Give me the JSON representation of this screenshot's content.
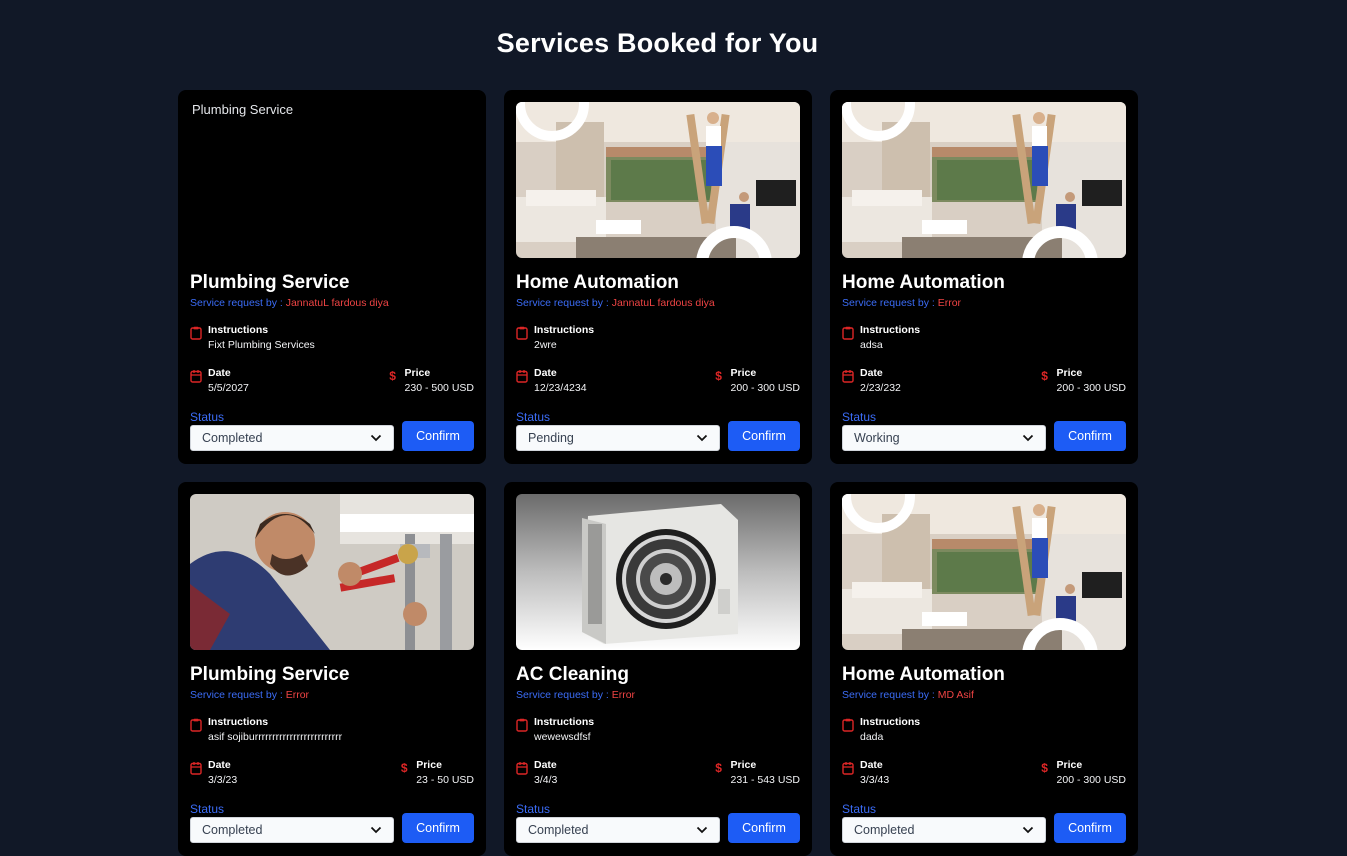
{
  "page": {
    "title": "Services Booked for You"
  },
  "labels": {
    "requested_by": "Service request by : ",
    "instructions": "Instructions",
    "date": "Date",
    "price": "Price",
    "status": "Status",
    "confirm": "Confirm"
  },
  "colors": {
    "background": "#111827",
    "card": "#000000",
    "accent_blue": "#1d5cf5",
    "accent_red": "#ef4444"
  },
  "cards": [
    {
      "title": "Plumbing Service",
      "image": "broken-image",
      "image_alt": "Plumbing Service",
      "requester": "JannatuL fardous diya",
      "instructions": "Fixt Plumbing Services",
      "date": "5/5/2027",
      "price": "230 - 500 USD",
      "status": "Completed"
    },
    {
      "title": "Home Automation",
      "image": "home-automation-photo",
      "requester": "JannatuL fardous diya",
      "instructions": "2wre",
      "date": "12/23/4234",
      "price": "200 - 300 USD",
      "status": "Pending"
    },
    {
      "title": "Home Automation",
      "image": "home-automation-photo",
      "requester": "Error",
      "instructions": "adsa",
      "date": "2/23/232",
      "price": "200 - 300 USD",
      "status": "Working"
    },
    {
      "title": "Plumbing Service",
      "image": "plumber-photo",
      "requester": "Error",
      "instructions": "asif sojiburrrrrrrrrrrrrrrrrrrrrrrrr",
      "date": "3/3/23",
      "price": "23 - 50 USD",
      "status": "Completed"
    },
    {
      "title": "AC Cleaning",
      "image": "ac-unit-photo",
      "requester": "Error",
      "instructions": "wewewsdfsf",
      "date": "3/4/3",
      "price": "231 - 543 USD",
      "status": "Completed"
    },
    {
      "title": "Home Automation",
      "image": "home-automation-photo",
      "requester": "MD Asif",
      "instructions": "dada",
      "date": "3/3/43",
      "price": "200 - 300 USD",
      "status": "Completed"
    }
  ]
}
